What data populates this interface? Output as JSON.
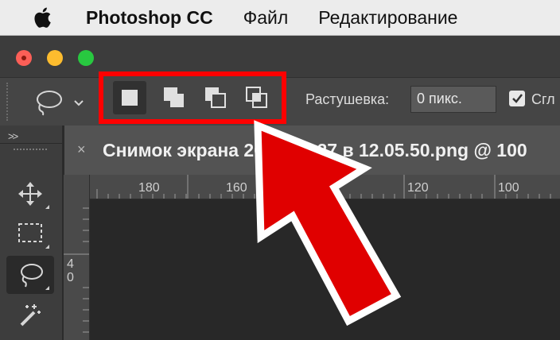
{
  "menubar": {
    "app": "Photoshop CC",
    "items": [
      "Файл",
      "Редактирование"
    ]
  },
  "options": {
    "feather_label": "Растушевка:",
    "feather_value": "0 пикс.",
    "smooth_label": "Сгл",
    "smooth_checked": true,
    "selection_modes": [
      "new-selection",
      "add-to-selection",
      "subtract-from-selection",
      "intersect-with-selection"
    ],
    "active_mode": "new-selection"
  },
  "toolbar": {
    "collapse": ">>",
    "tools": [
      "move-tool",
      "marquee-tool",
      "lasso-tool",
      "magic-wand-tool"
    ],
    "active_tool": "lasso-tool"
  },
  "document": {
    "close": "×",
    "title": "Снимок экрана 2019-06-27 в 12.05.50.png @ 100",
    "ruler_top": [
      "180",
      "160",
      "120",
      "100"
    ],
    "ruler_left": [
      "4",
      "0"
    ]
  },
  "annotation": {
    "highlight_color": "#ff0000",
    "arrow_color": "#e00000"
  }
}
